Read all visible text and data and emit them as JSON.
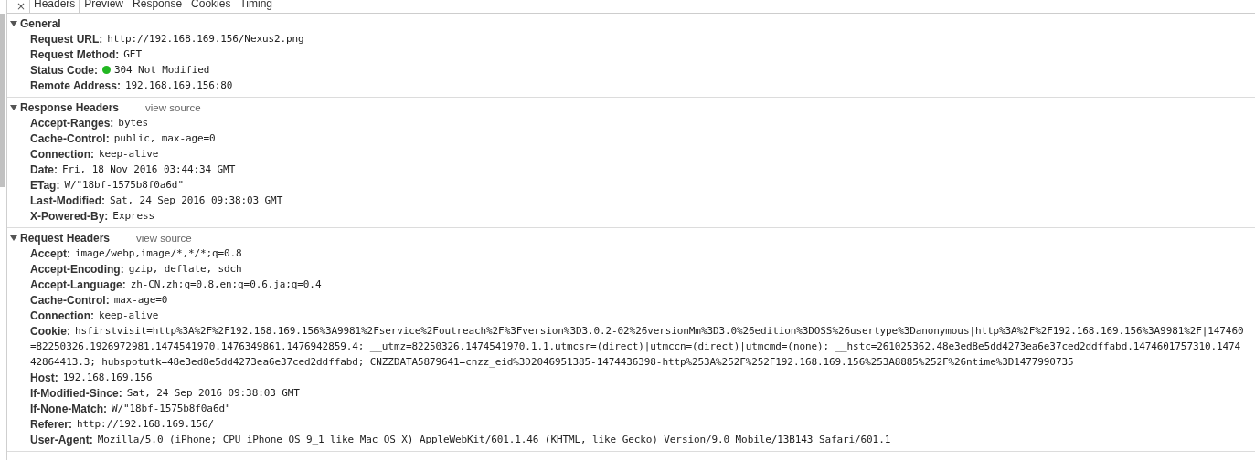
{
  "close_button": {
    "label": "×"
  },
  "tabs": [
    {
      "label": "Headers",
      "selected": true
    },
    {
      "label": "Preview",
      "selected": false
    },
    {
      "label": "Response",
      "selected": false
    },
    {
      "label": "Cookies",
      "selected": false
    },
    {
      "label": "Timing",
      "selected": false
    }
  ],
  "sections": [
    {
      "title": "General",
      "expanded": true,
      "rows": [
        {
          "name": "Request URL:",
          "value": "http://192.168.169.156/Nexus2.png"
        },
        {
          "name": "Request Method:",
          "value": "GET"
        },
        {
          "name": "Status Code:",
          "value": "304 Not Modified",
          "color": "#22b722"
        },
        {
          "name": "Remote Address:",
          "value": "192.168.169.156:80"
        }
      ]
    },
    {
      "title": "Response Headers",
      "link": "view source",
      "expanded": true,
      "rows": [
        {
          "name": "Accept-Ranges:",
          "value": "bytes"
        },
        {
          "name": "Cache-Control:",
          "value": "public, max-age=0"
        },
        {
          "name": "Connection:",
          "value": "keep-alive"
        },
        {
          "name": "Date:",
          "value": "Fri, 18 Nov 2016 03:44:34 GMT"
        },
        {
          "name": "ETag:",
          "value": "W/\"18bf-1575b8f0a6d\""
        },
        {
          "name": "Last-Modified:",
          "value": "Sat, 24 Sep 2016 09:38:03 GMT"
        },
        {
          "name": "X-Powered-By:",
          "value": "Express"
        }
      ]
    },
    {
      "title": "Request Headers",
      "link": "view source",
      "expanded": true,
      "rows": [
        {
          "name": "Accept:",
          "value": "image/webp,image/*,*/*;q=0.8"
        },
        {
          "name": "Accept-Encoding:",
          "value": "gzip, deflate, sdch"
        },
        {
          "name": "Accept-Language:",
          "value": "zh-CN,zh;q=0.8,en;q=0.6,ja;q=0.4"
        },
        {
          "name": "Cache-Control:",
          "value": "max-age=0"
        },
        {
          "name": "Connection:",
          "value": "keep-alive"
        },
        {
          "name": "Cookie:",
          "value": "hsfirstvisit=http%3A%2F%2F192.168.169.156%3A9981%2Fservice%2Foutreach%2F%3Fversion%3D3.0.2-02%26versionMm%3D3.0%26edition%3DOSS%26usertype%3Danonymous|http%3A%2F%2F192.168.169.156%3A9981%2F|147460",
          "wrapped_lines": [
            "=82250326.1926972981.1474541970.1476349861.1476942859.4; __utmz=82250326.1474541970.1.1.utmcsr=(direct)|utmccn=(direct)|utmcmd=(none); __hstc=261025362.48e3ed8e5dd4273ea6e37ced2ddffabd.1474601757310.1474",
            "42864413.3; hubspotutk=48e3ed8e5dd4273ea6e37ced2ddffabd; CNZZDATA5879641=cnzz_eid%3D2046951385-1474436398-http%253A%252F%252F192.168.169.156%253A8885%252F%26ntime%3D1477990735"
          ]
        },
        {
          "name": "Host:",
          "value": "192.168.169.156"
        },
        {
          "name": "If-Modified-Since:",
          "value": "Sat, 24 Sep 2016 09:38:03 GMT"
        },
        {
          "name": "If-None-Match:",
          "value": "W/\"18bf-1575b8f0a6d\""
        },
        {
          "name": "Referer:",
          "value": "http://192.168.169.156/"
        },
        {
          "name": "User-Agent:",
          "value": "Mozilla/5.0 (iPhone; CPU iPhone OS 9_1 like Mac OS X) AppleWebKit/601.1.46 (KHTML, like Gecko) Version/9.0 Mobile/13B143 Safari/601.1"
        }
      ]
    }
  ]
}
